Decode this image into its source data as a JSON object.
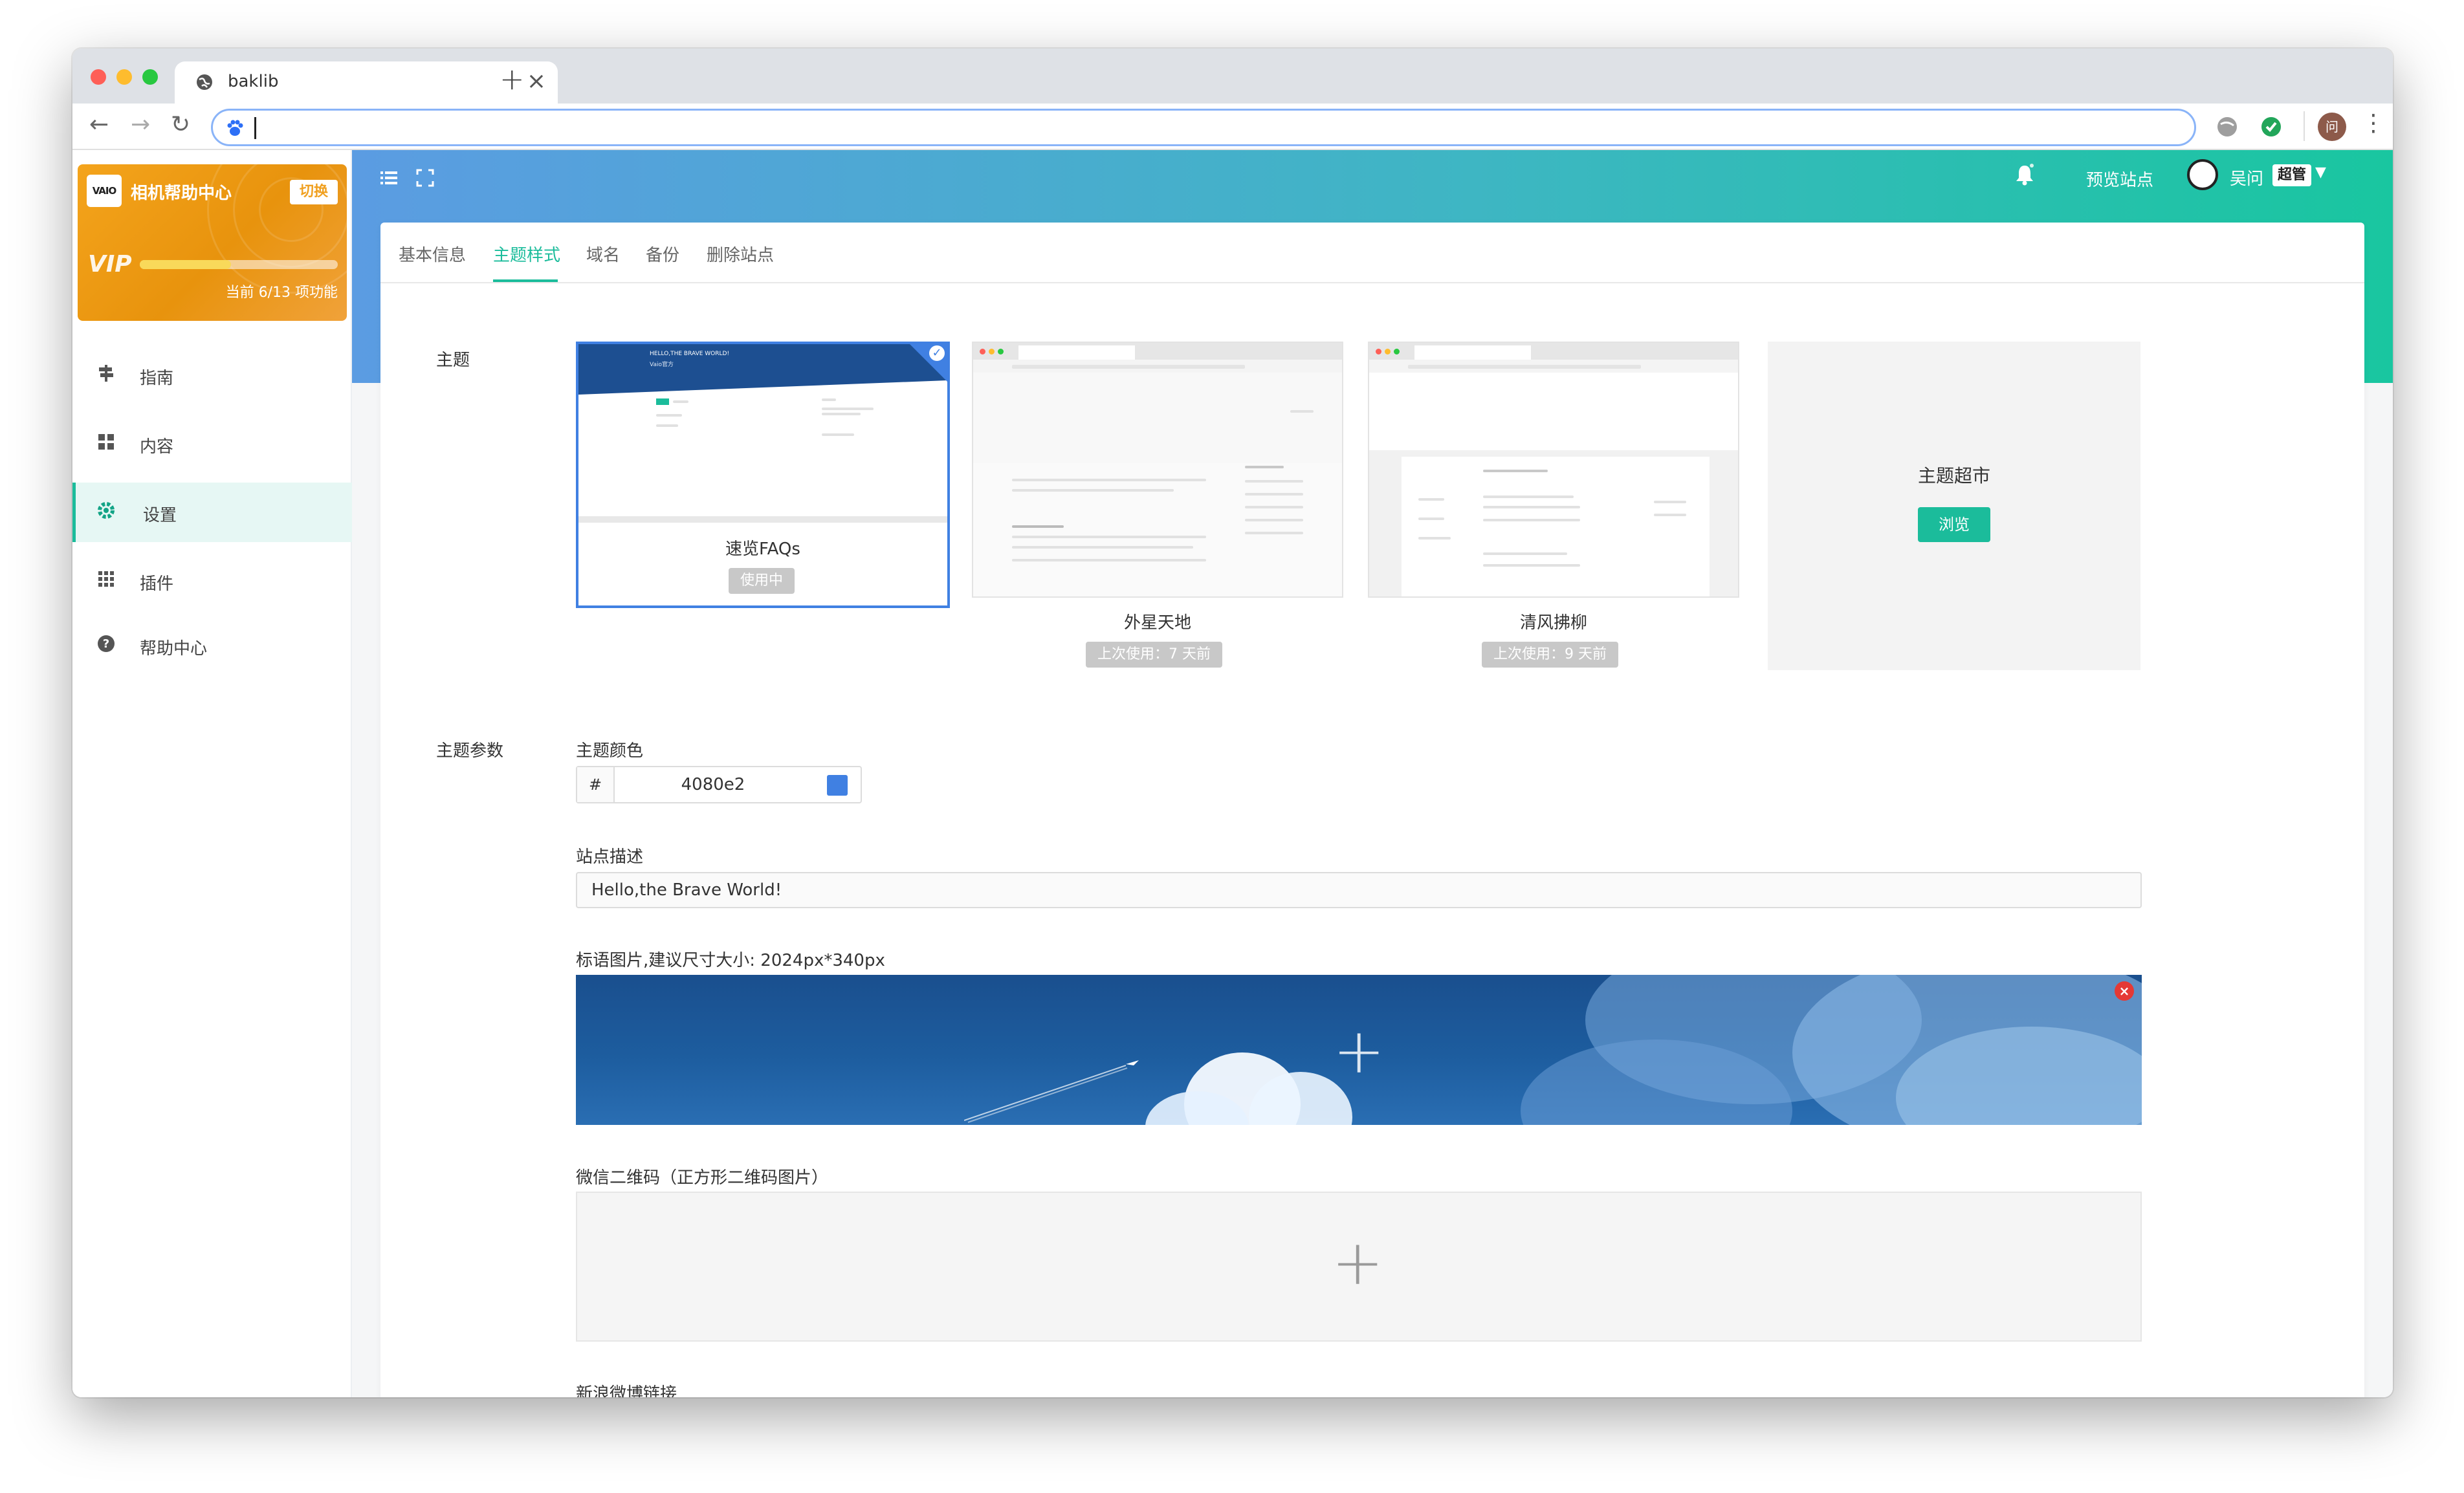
{
  "browser": {
    "tab_title": "baklib",
    "tab_close": "×",
    "new_tab": "+",
    "address_value": "",
    "nav_back": "←",
    "nav_forward": "→",
    "nav_reload": "↻",
    "menu_dots": "⋮",
    "profile_initial": "问"
  },
  "sidebar": {
    "logo_text": "VAIO",
    "site_name": "相机帮助中心",
    "switch_label": "切换",
    "vip_label": "VIP",
    "vip_progress": 0.46,
    "vip_progress_text": "当前 6/13 项功能",
    "items": [
      {
        "label": "指南",
        "icon": "signpost-icon"
      },
      {
        "label": "内容",
        "icon": "grid-icon"
      },
      {
        "label": "设置",
        "icon": "gear-icon"
      },
      {
        "label": "插件",
        "icon": "apps-icon"
      },
      {
        "label": "帮助中心",
        "icon": "question-icon"
      }
    ]
  },
  "header": {
    "preview_label": "预览站点",
    "user_name": "吴问",
    "role_badge": "超管"
  },
  "tabs": [
    "基本信息",
    "主题样式",
    "域名",
    "备份",
    "删除站点"
  ],
  "active_tab": "主题样式",
  "theme_section": {
    "label": "主题",
    "themes": [
      {
        "name": "速览FAQs",
        "status": "使用中",
        "active": true,
        "thumb_title": "HELLO,THE BRAVE WORLD!",
        "thumb_sub": "Vaio官方"
      },
      {
        "name": "外星天地",
        "status": "上次使用：7 天前",
        "active": false
      },
      {
        "name": "清风拂柳",
        "status": "上次使用：9 天前",
        "active": false
      }
    ],
    "market_title": "主题超市",
    "market_button": "浏览"
  },
  "params": {
    "label": "主题参数",
    "color_label": "主题颜色",
    "color_hash": "#",
    "color_value": "4080e2",
    "color_swatch": "#4080e2",
    "desc_label": "站点描述",
    "desc_value": "Hello,the Brave World!",
    "banner_label": "标语图片,建议尺寸大小: 2024px*340px",
    "wechat_label": "微信二维码（正方形二维码图片）",
    "weibo_label": "新浪微博链接"
  },
  "colors": {
    "accent": "#1bbc9b",
    "theme_blue": "#4080e2",
    "vip_orange": "#f0a020"
  }
}
